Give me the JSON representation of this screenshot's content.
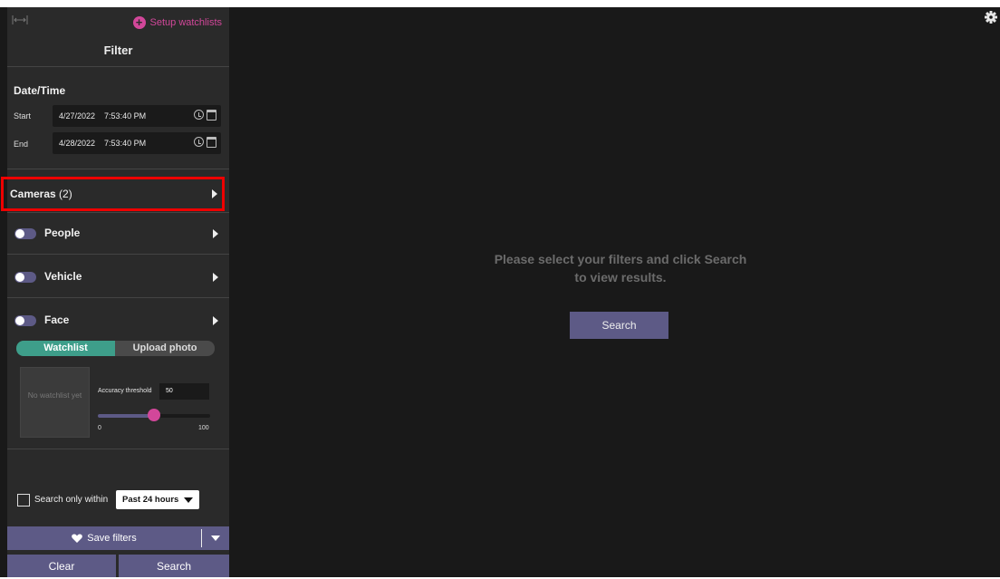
{
  "sidebar": {
    "setup_link": "Setup watchlists",
    "title": "Filter",
    "datetime": {
      "heading": "Date/Time",
      "start_label": "Start",
      "start_date": "4/27/2022",
      "start_time": "7:53:40 PM",
      "end_label": "End",
      "end_date": "4/28/2022",
      "end_time": "7:53:40 PM"
    },
    "cameras": {
      "label": "Cameras",
      "count": "(2)"
    },
    "people": {
      "label": "People",
      "enabled": false
    },
    "vehicle": {
      "label": "Vehicle",
      "enabled": false
    },
    "face": {
      "label": "Face",
      "enabled": false,
      "tabs": [
        "Watchlist",
        "Upload photo"
      ],
      "active_tab": "Watchlist",
      "empty_watchlist": "No watchlist yet",
      "accuracy_label": "Accuracy threshold",
      "accuracy_value": "50",
      "slider_min": "0",
      "slider_max": "100",
      "slider_value": 50
    },
    "search_within": {
      "label": "Search only within",
      "checked": false,
      "selected": "Past 24 hours"
    },
    "save_filters": "Save filters",
    "clear": "Clear",
    "search": "Search"
  },
  "main": {
    "message": "Please select your filters and click Search to view results.",
    "search_button": "Search"
  },
  "colors": {
    "accent": "#5d5a86",
    "pink": "#d2479a",
    "teal": "#3e9e8a",
    "highlight": "#ee0000",
    "panel": "#2a2a2a",
    "background": "#191919"
  },
  "icons": [
    "collapse-icon",
    "plus-circle-icon",
    "clock-icon",
    "calendar-icon",
    "chevron-right-icon",
    "heart-icon",
    "caret-down-icon",
    "gear-icon"
  ]
}
